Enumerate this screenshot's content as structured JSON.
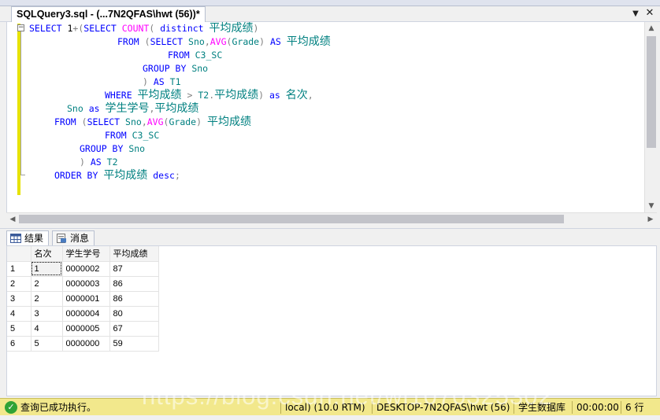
{
  "doc_tab": {
    "title": "SQLQuery3.sql - (...7N2QFAS\\hwt (56))*"
  },
  "code_lines": [
    [
      {
        "c": "kw",
        "t": "SELECT "
      },
      {
        "c": "",
        "t": "1"
      },
      {
        "c": "op",
        "t": "+("
      },
      {
        "c": "kw",
        "t": "SELECT "
      },
      {
        "c": "fn",
        "t": "COUNT"
      },
      {
        "c": "op",
        "t": "( "
      },
      {
        "c": "kw",
        "t": "distinct "
      },
      {
        "c": "cn",
        "t": "平均成绩"
      },
      {
        "c": "op",
        "t": ")"
      }
    ],
    [
      {
        "c": "kw",
        "t": "FROM "
      },
      {
        "c": "op",
        "t": "("
      },
      {
        "c": "kw",
        "t": "SELECT "
      },
      {
        "c": "id",
        "t": "Sno"
      },
      {
        "c": "op",
        "t": ","
      },
      {
        "c": "fn",
        "t": "AVG"
      },
      {
        "c": "op",
        "t": "("
      },
      {
        "c": "id",
        "t": "Grade"
      },
      {
        "c": "op",
        "t": ") "
      },
      {
        "c": "kw",
        "t": "AS "
      },
      {
        "c": "cn",
        "t": "平均成绩"
      }
    ],
    [
      {
        "c": "kw",
        "t": "FROM "
      },
      {
        "c": "id",
        "t": "C3_SC"
      }
    ],
    [
      {
        "c": "kw",
        "t": "GROUP BY "
      },
      {
        "c": "id",
        "t": "Sno"
      }
    ],
    [
      {
        "c": "op",
        "t": ") "
      },
      {
        "c": "kw",
        "t": "AS "
      },
      {
        "c": "id",
        "t": "T1"
      }
    ],
    [
      {
        "c": "kw",
        "t": "WHERE "
      },
      {
        "c": "cn",
        "t": "平均成绩"
      },
      {
        "c": "op",
        "t": " > "
      },
      {
        "c": "id",
        "t": "T2"
      },
      {
        "c": "op",
        "t": "."
      },
      {
        "c": "cn",
        "t": "平均成绩"
      },
      {
        "c": "op",
        "t": ") "
      },
      {
        "c": "kw",
        "t": "as "
      },
      {
        "c": "cn",
        "t": "名次"
      },
      {
        "c": "op",
        "t": ","
      }
    ],
    [
      {
        "c": "id",
        "t": "Sno "
      },
      {
        "c": "kw",
        "t": "as "
      },
      {
        "c": "cn",
        "t": "学生学号"
      },
      {
        "c": "op",
        "t": ","
      },
      {
        "c": "cn",
        "t": "平均成绩"
      }
    ],
    [
      {
        "c": "kw",
        "t": "FROM "
      },
      {
        "c": "op",
        "t": "("
      },
      {
        "c": "kw",
        "t": "SELECT "
      },
      {
        "c": "id",
        "t": "Sno"
      },
      {
        "c": "op",
        "t": ","
      },
      {
        "c": "fn",
        "t": "AVG"
      },
      {
        "c": "op",
        "t": "("
      },
      {
        "c": "id",
        "t": "Grade"
      },
      {
        "c": "op",
        "t": ") "
      },
      {
        "c": "cn",
        "t": "平均成绩"
      }
    ],
    [
      {
        "c": "kw",
        "t": "FROM "
      },
      {
        "c": "id",
        "t": "C3_SC"
      }
    ],
    [
      {
        "c": "kw",
        "t": "GROUP BY "
      },
      {
        "c": "id",
        "t": "Sno"
      }
    ],
    [
      {
        "c": "op",
        "t": ") "
      },
      {
        "c": "kw",
        "t": "AS "
      },
      {
        "c": "id",
        "t": "T2"
      }
    ],
    [
      {
        "c": "kw",
        "t": "ORDER BY "
      },
      {
        "c": "cn",
        "t": "平均成绩"
      },
      {
        "c": "kw",
        "t": " desc"
      },
      {
        "c": "op",
        "t": ";"
      }
    ]
  ],
  "result_tabs": [
    {
      "label": "结果"
    },
    {
      "label": "消息"
    }
  ],
  "grid": {
    "columns": [
      "名次",
      "学生学号",
      "平均成绩"
    ],
    "rows": [
      [
        "1",
        "1",
        "0000002",
        "87"
      ],
      [
        "2",
        "2",
        "0000003",
        "86"
      ],
      [
        "3",
        "2",
        "0000001",
        "86"
      ],
      [
        "4",
        "3",
        "0000004",
        "80"
      ],
      [
        "5",
        "4",
        "0000005",
        "67"
      ],
      [
        "6",
        "5",
        "0000000",
        "59"
      ]
    ]
  },
  "status": {
    "message": "查询已成功执行。",
    "server": "local) (10.0 RTM)",
    "connection": "DESKTOP-7N2QFAS\\hwt (56)",
    "database": "学生数据库",
    "time": "00:00:00",
    "rows": "6 行"
  },
  "watermark": "https://blog.csdn.net/wl1070325302"
}
